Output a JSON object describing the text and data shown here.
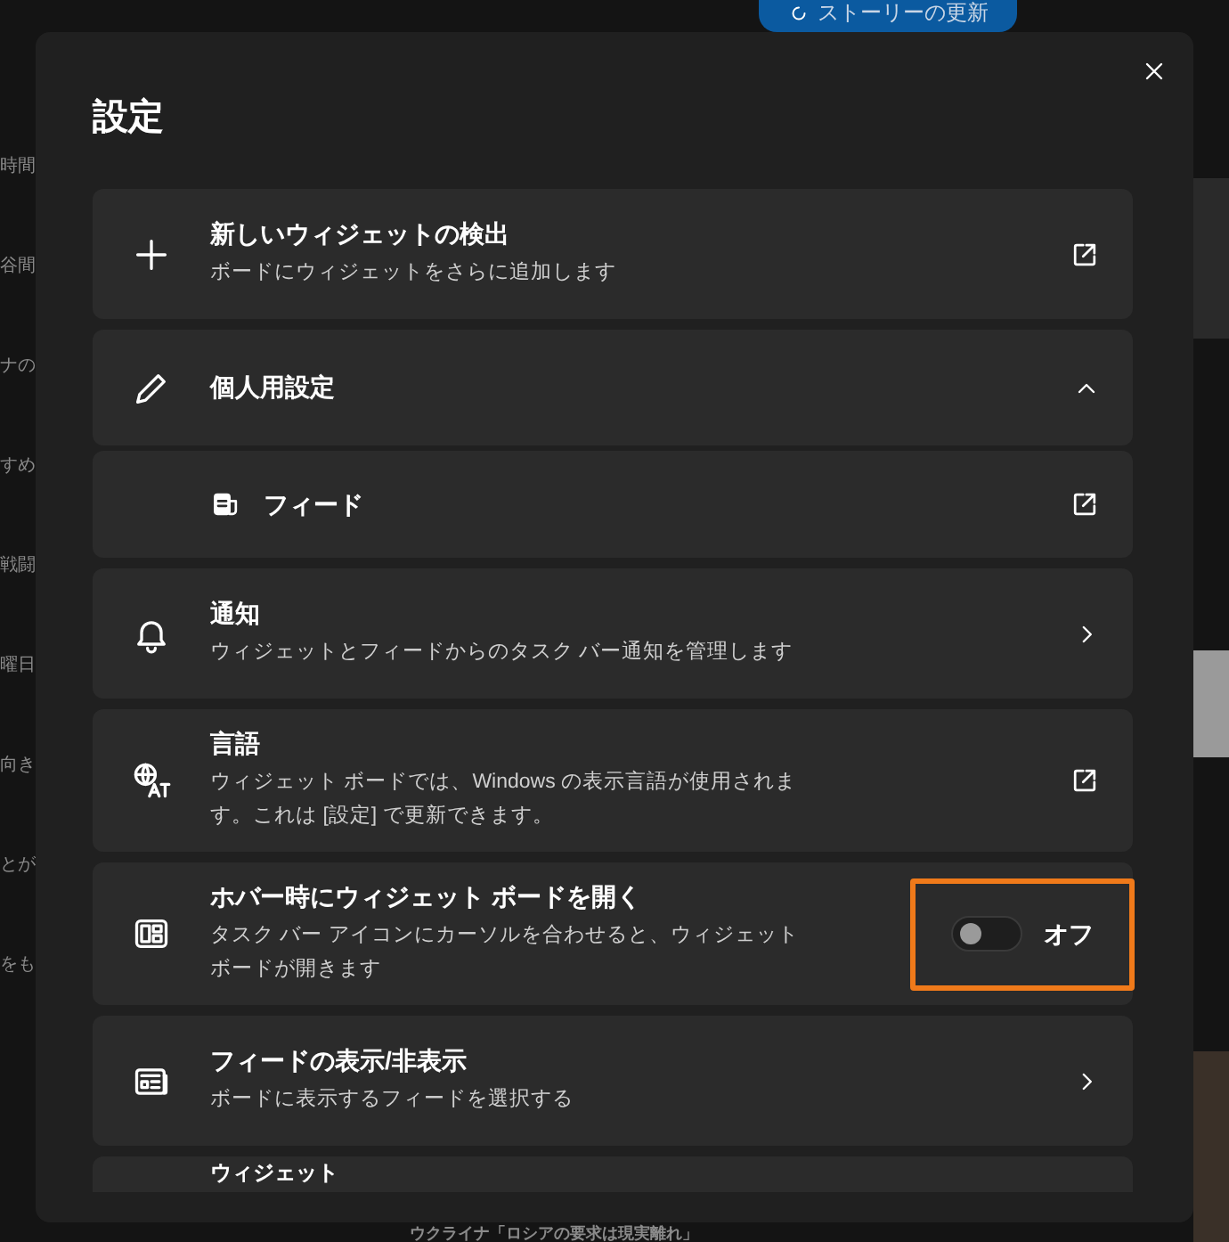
{
  "background": {
    "refresh_button": "ストーリーの更新",
    "fragments": [
      "時間",
      "谷間",
      "ナの",
      "すめ",
      "戦闘",
      "曜日",
      "向き",
      "とが",
      "をも"
    ],
    "headline": "ウクライナ「ロシアの要求は現実離れ」"
  },
  "dialog": {
    "title": "設定",
    "items": [
      {
        "kind": "link",
        "title": "新しいウィジェットの検出",
        "subtitle": "ボードにウィジェットをさらに追加します"
      },
      {
        "kind": "expander",
        "title": "個人用設定",
        "expanded": true,
        "children": [
          {
            "title": "フィード"
          }
        ]
      },
      {
        "kind": "nav",
        "title": "通知",
        "subtitle": "ウィジェットとフィードからのタスク バー通知を管理します"
      },
      {
        "kind": "link",
        "title": "言語",
        "subtitle": "ウィジェット ボードでは、Windows の表示言語が使用されます。これは [設定] で更新できます。"
      },
      {
        "kind": "toggle",
        "title": "ホバー時にウィジェット ボードを開く",
        "subtitle": "タスク バー アイコンにカーソルを合わせると、ウィジェットボードが開きます",
        "on": false,
        "state_label": "オフ",
        "highlighted": true
      },
      {
        "kind": "nav",
        "title": "フィードの表示/非表示",
        "subtitle": "ボードに表示するフィードを選択する"
      },
      {
        "kind": "partial",
        "title": "ウィジェット"
      }
    ]
  }
}
